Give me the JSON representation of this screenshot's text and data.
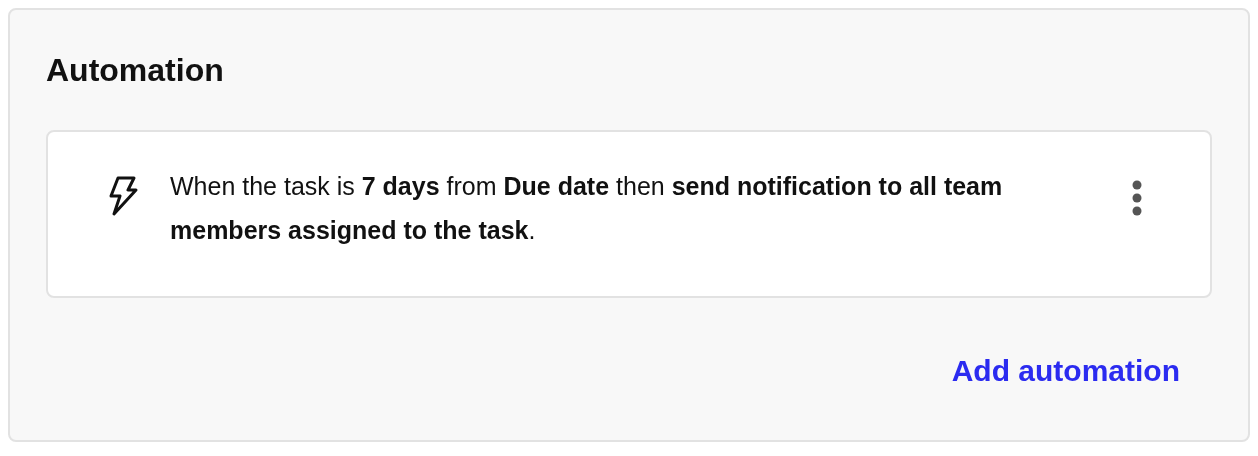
{
  "title": "Automation",
  "automations": [
    {
      "text": "When the task is **7 days** from **Due date** then **send notification to all team members assigned to the task**."
    }
  ],
  "add_button": "Add automation"
}
